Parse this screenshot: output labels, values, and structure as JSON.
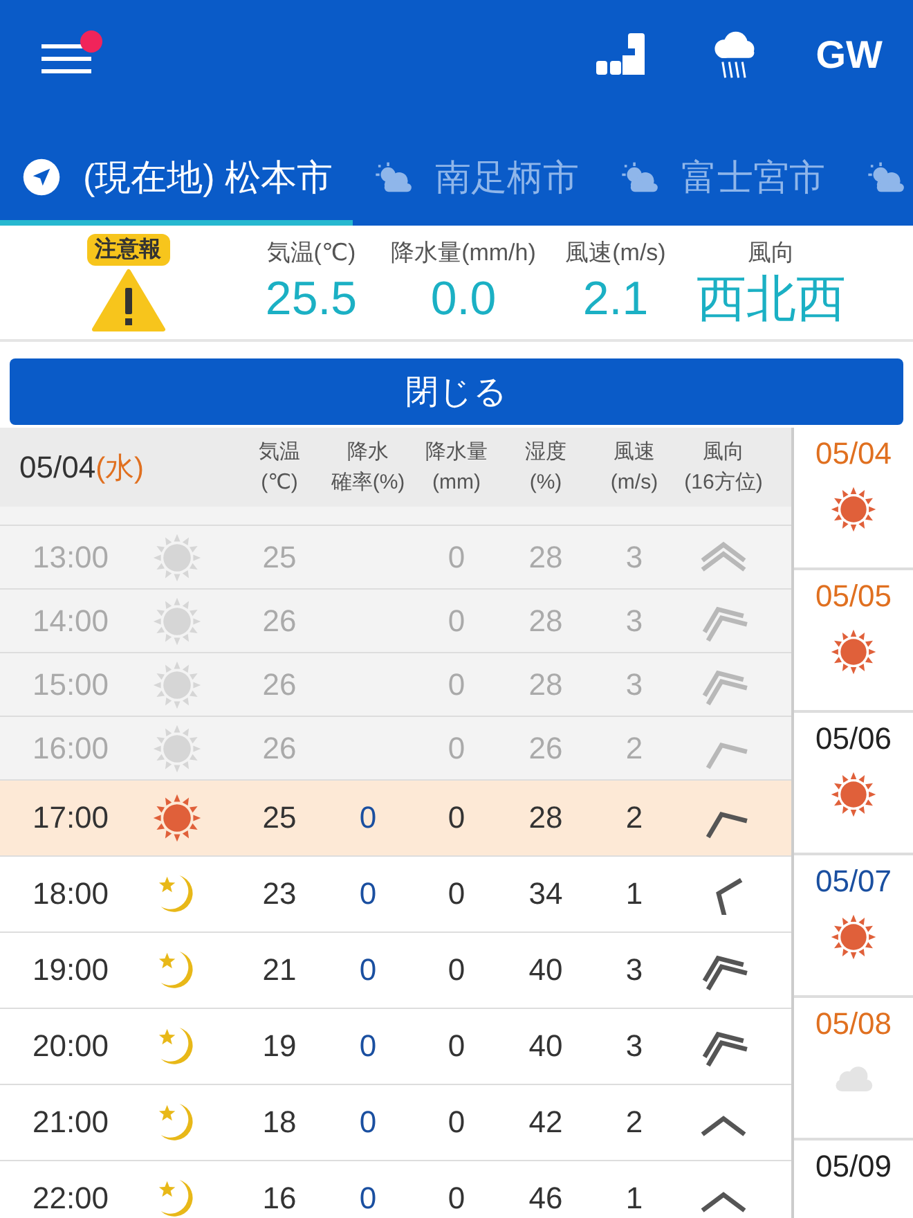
{
  "top_bar": {
    "menu_badge": true,
    "action_label": "GW"
  },
  "tabs": [
    {
      "label": "(現在地) 松本市",
      "kind": "location",
      "selected": true
    },
    {
      "label": "南足柄市",
      "kind": "weather",
      "selected": false
    },
    {
      "label": "富士宮市",
      "kind": "weather",
      "selected": false
    },
    {
      "kind": "weather",
      "selected": false
    }
  ],
  "summary": {
    "alert_badge": "注意報",
    "readings": [
      {
        "label": "気温(℃)",
        "value": "25.5"
      },
      {
        "label": "降水量(mm/h)",
        "value": "0.0"
      },
      {
        "label": "風速(m/s)",
        "value": "2.1"
      },
      {
        "label": "風向",
        "value": "西北西"
      }
    ]
  },
  "close_button": "閉じる",
  "table": {
    "date": "05/04",
    "weekday": "(水)",
    "columns": [
      {
        "top": "気温",
        "bottom": "(℃)"
      },
      {
        "top": "降水",
        "bottom": "確率(%)"
      },
      {
        "top": "降水量",
        "bottom": "(mm)"
      },
      {
        "top": "湿度",
        "bottom": "(%)"
      },
      {
        "top": "風速",
        "bottom": "(m/s)"
      },
      {
        "top": "風向",
        "bottom": "(16方位)"
      }
    ],
    "rows": [
      {
        "time": "13:00",
        "kind": "past",
        "weather": {
          "kind": "sun"
        },
        "temp": "25",
        "amount": "0",
        "humidity": "28",
        "speed": "3",
        "direction": {
          "kind": "n"
        },
        "arrow": {
          "kind": "double"
        }
      },
      {
        "time": "14:00",
        "kind": "past",
        "weather": {
          "kind": "sun"
        },
        "temp": "26",
        "amount": "0",
        "humidity": "28",
        "speed": "3",
        "direction": {
          "kind": "nnw"
        },
        "arrow": {
          "kind": "double"
        }
      },
      {
        "time": "15:00",
        "kind": "past",
        "weather": {
          "kind": "sun"
        },
        "temp": "26",
        "amount": "0",
        "humidity": "28",
        "speed": "3",
        "direction": {
          "kind": "nnw"
        },
        "arrow": {
          "kind": "double"
        }
      },
      {
        "time": "16:00",
        "kind": "past",
        "weather": {
          "kind": "sun"
        },
        "temp": "26",
        "amount": "0",
        "humidity": "26",
        "speed": "2",
        "direction": {
          "kind": "nnw"
        },
        "arrow": {
          "kind": "single"
        }
      },
      {
        "time": "17:00",
        "kind": "current",
        "weather": {
          "kind": "sun"
        },
        "temp": "25",
        "prob": "0",
        "amount": "0",
        "humidity": "28",
        "speed": "2",
        "direction": {
          "kind": "nnw"
        },
        "arrow": {
          "kind": "single"
        }
      },
      {
        "time": "18:00",
        "kind": "future",
        "weather": {
          "kind": "moon"
        },
        "temp": "23",
        "prob": "0",
        "amount": "0",
        "humidity": "34",
        "speed": "1",
        "direction": {
          "kind": "wnw"
        },
        "arrow": {
          "kind": "single"
        }
      },
      {
        "time": "19:00",
        "kind": "future",
        "weather": {
          "kind": "moon"
        },
        "temp": "21",
        "prob": "0",
        "amount": "0",
        "humidity": "40",
        "speed": "3",
        "direction": {
          "kind": "nnw"
        },
        "arrow": {
          "kind": "double"
        }
      },
      {
        "time": "20:00",
        "kind": "future",
        "weather": {
          "kind": "moon"
        },
        "temp": "19",
        "prob": "0",
        "amount": "0",
        "humidity": "40",
        "speed": "3",
        "direction": {
          "kind": "nnw"
        },
        "arrow": {
          "kind": "double"
        }
      },
      {
        "time": "21:00",
        "kind": "future",
        "weather": {
          "kind": "moon"
        },
        "temp": "18",
        "prob": "0",
        "amount": "0",
        "humidity": "42",
        "speed": "2",
        "direction": {
          "kind": "n"
        },
        "arrow": {
          "kind": "single"
        }
      },
      {
        "time": "22:00",
        "kind": "future",
        "weather": {
          "kind": "moon"
        },
        "temp": "16",
        "prob": "0",
        "amount": "0",
        "humidity": "46",
        "speed": "1",
        "direction": {
          "kind": "n"
        },
        "arrow": {
          "kind": "single"
        }
      }
    ]
  },
  "days": [
    {
      "date": "05/04",
      "color": "#e07020",
      "weather": {
        "kind": "sun"
      }
    },
    {
      "date": "05/05",
      "color": "#e07020",
      "weather": {
        "kind": "sun"
      }
    },
    {
      "date": "05/06",
      "color": "#222222",
      "weather": {
        "kind": "sun"
      }
    },
    {
      "date": "05/07",
      "color": "#1a4fa0",
      "weather": {
        "kind": "sun"
      }
    },
    {
      "date": "05/08",
      "color": "#e07020",
      "weather": {
        "kind": "cloud"
      }
    },
    {
      "date": "05/09",
      "color": "#222222"
    }
  ]
}
